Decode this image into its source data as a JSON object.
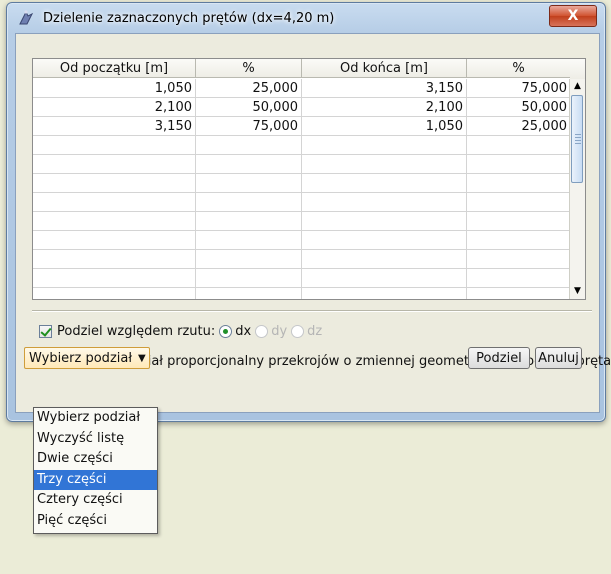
{
  "window": {
    "title": "Dzielenie zaznaczonych prętów (dx=4,20 m)",
    "close_label": "X"
  },
  "table": {
    "headers": [
      "Od początku [m]",
      "%",
      "Od końca [m]",
      "%"
    ],
    "rows": [
      [
        "1,050",
        "25,000",
        "3,150",
        "75,000"
      ],
      [
        "2,100",
        "50,000",
        "2,100",
        "50,000"
      ],
      [
        "3,150",
        "75,000",
        "1,050",
        "25,000"
      ],
      [
        "",
        "",
        "",
        ""
      ],
      [
        "",
        "",
        "",
        ""
      ],
      [
        "",
        "",
        "",
        ""
      ],
      [
        "",
        "",
        "",
        ""
      ],
      [
        "",
        "",
        "",
        ""
      ],
      [
        "",
        "",
        "",
        ""
      ],
      [
        "",
        "",
        "",
        ""
      ],
      [
        "",
        "",
        "",
        ""
      ],
      [
        "",
        "",
        "",
        ""
      ]
    ]
  },
  "options": {
    "projection_label": "Podziel względem rzutu:",
    "projection_checked": true,
    "radio_dx": "dx",
    "radio_dy": "dy",
    "radio_dz": "dz",
    "selected_projection": "dx",
    "proportional_label": "Zastosuj podział proporcjonalny przekrojów o zmiennej geometrii przy podziale pręta",
    "proportional_checked": true
  },
  "combo": {
    "value": "Wybierz podział",
    "options": [
      "Wybierz podział",
      "Wyczyść listę",
      "Dwie części",
      "Trzy części",
      "Cztery części",
      "Pięć części"
    ],
    "highlighted": "Trzy części"
  },
  "buttons": {
    "split": "Podziel",
    "cancel": "Anuluj"
  },
  "colors": {
    "highlight": "#3175d6",
    "check_green": "#1e8f1e",
    "close_red": "#c13f1c"
  }
}
